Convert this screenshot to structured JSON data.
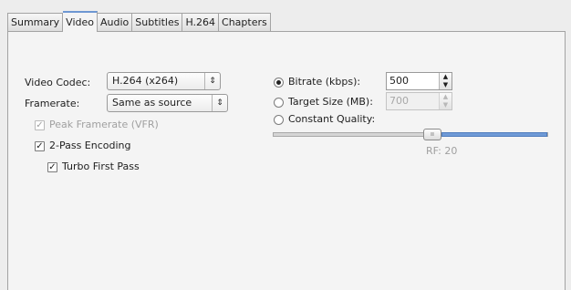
{
  "tabs": [
    "Summary",
    "Video",
    "Audio",
    "Subtitles",
    "H.264",
    "Chapters"
  ],
  "active_tab": 1,
  "video": {
    "codec_label": "Video Codec:",
    "codec_value": "H.264 (x264)",
    "framerate_label": "Framerate:",
    "framerate_value": "Same as source",
    "peak_framerate_label": "Peak Framerate (VFR)",
    "peak_framerate_checked": true,
    "peak_framerate_enabled": false,
    "two_pass_label": "2-Pass Encoding",
    "two_pass_checked": true,
    "turbo_label": "Turbo First Pass",
    "turbo_checked": true
  },
  "quality": {
    "bitrate_label": "Bitrate (kbps):",
    "bitrate_value": "500",
    "bitrate_selected": true,
    "target_size_label": "Target Size (MB):",
    "target_size_value": "700",
    "target_size_enabled": false,
    "constant_quality_label": "Constant Quality:",
    "rf_label": "RF: 20",
    "slider_fraction": 0.58
  },
  "glyphs": {
    "check": "✓",
    "combo_arrows": "⇕",
    "spin_up": "▲",
    "spin_down": "▼",
    "grip": "ıı"
  },
  "colors": {
    "accent": "#6f9ad6",
    "tab_highlight": "#6d97d2",
    "disabled": "#a0a0a0"
  }
}
